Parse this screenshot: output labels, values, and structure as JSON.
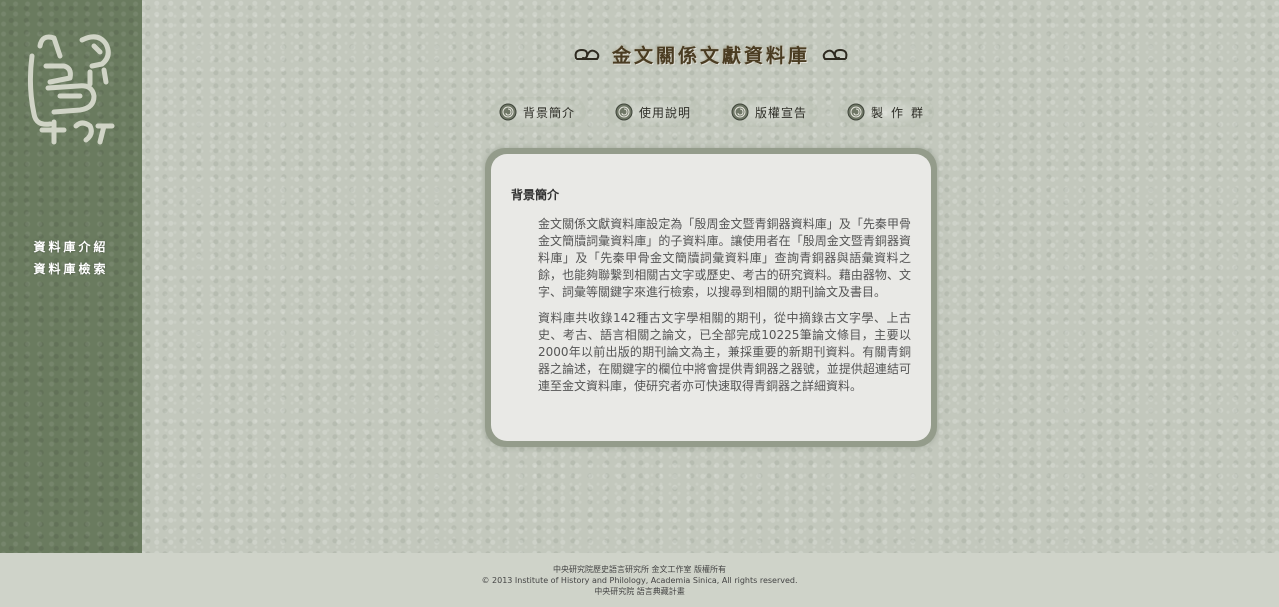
{
  "header": {
    "title": "金文關係文獻資料庫"
  },
  "sidebar": {
    "links": [
      {
        "label": "資料庫介紹"
      },
      {
        "label": "資料庫檢索"
      }
    ]
  },
  "tabs": [
    {
      "label": "背景簡介"
    },
    {
      "label": "使用說明"
    },
    {
      "label": "版權宣告"
    },
    {
      "label": "製作群"
    }
  ],
  "content": {
    "section_title": "背景簡介",
    "paragraphs": [
      "金文關係文獻資料庫設定為「殷周金文暨青銅器資料庫」及「先秦甲骨金文簡牘詞彙資料庫」的子資料庫。讓使用者在「殷周金文暨青銅器資料庫」及「先秦甲骨金文簡牘詞彙資料庫」查詢青銅器與語彙資料之餘，也能夠聯繫到相關古文字或歷史、考古的研究資料。藉由器物、文字、詞彙等關鍵字來進行檢索，以搜尋到相關的期刊論文及書目。",
      "資料庫共收錄142種古文字學相關的期刊，從中摘錄古文字學、上古史、考古、語言相關之論文，已全部完成10225筆論文條目，主要以2000年以前出版的期刊論文為主，兼採重要的新期刊資料。有關青銅器之論述，在關鍵字的欄位中將會提供青銅器之器號，並提供超連結可連至金文資料庫，使研究者亦可快速取得青銅器之詳細資料。"
    ]
  },
  "footer": {
    "line1": "中央研究院歷史語言研究所 金文工作室 版權所有",
    "line2": "© 2013 Institute of History and Philology, Academia Sinica, All rights reserved.",
    "line3": "中央研究院 語言典藏計畫"
  },
  "colors": {
    "sidebar": "#6a7b5f",
    "background": "#c3c8bd",
    "panel": "#e9e9e6",
    "panel_border": "#949c8b",
    "title": "#4a3c22"
  },
  "icons": {
    "tab_icon": "spiral-coin-icon",
    "title_ornament": "cloud-scroll-icon",
    "logo": "bronze-script-logo-icon"
  }
}
